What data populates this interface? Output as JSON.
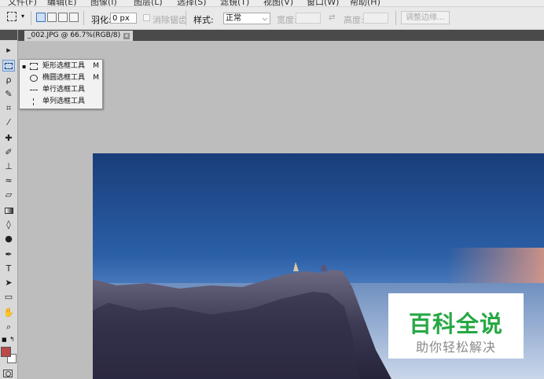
{
  "menubar": {
    "items": [
      "文件(F)",
      "编辑(E)",
      "图像(I)",
      "图层(L)",
      "选择(S)",
      "滤镜(T)",
      "视图(V)",
      "窗口(W)",
      "帮助(H)"
    ]
  },
  "options": {
    "feather_label": "羽化:",
    "feather_value": "0 px",
    "antialias_label": "消除锯齿",
    "style_label": "样式:",
    "style_value": "正常",
    "width_label": "宽度:",
    "height_label": "高度:",
    "refine_edge_label": "调整边缘..."
  },
  "document": {
    "tab_label": "_002.JPG @ 66.7%(RGB/8)",
    "close_glyph": "✕"
  },
  "flyout": {
    "items": [
      {
        "label": "矩形选框工具",
        "key": "M",
        "icon": "rect-marquee-icon",
        "selected": true
      },
      {
        "label": "椭圆选框工具",
        "key": "M",
        "icon": "ellipse-marquee-icon",
        "selected": false
      },
      {
        "label": "单行选框工具",
        "key": "",
        "icon": "single-row-marquee-icon",
        "selected": false
      },
      {
        "label": "单列选框工具",
        "key": "",
        "icon": "single-column-marquee-icon",
        "selected": false
      }
    ],
    "bullet": "▪"
  },
  "watermark": {
    "title": "百科全说",
    "subtitle": "助你轻松解决"
  },
  "colors": {
    "foreground": "#b94a48",
    "background": "#ffffff",
    "watermark_green": "#27a844",
    "sky_top": "#1a3d7a",
    "horizon_glow": "#d98c7a"
  }
}
